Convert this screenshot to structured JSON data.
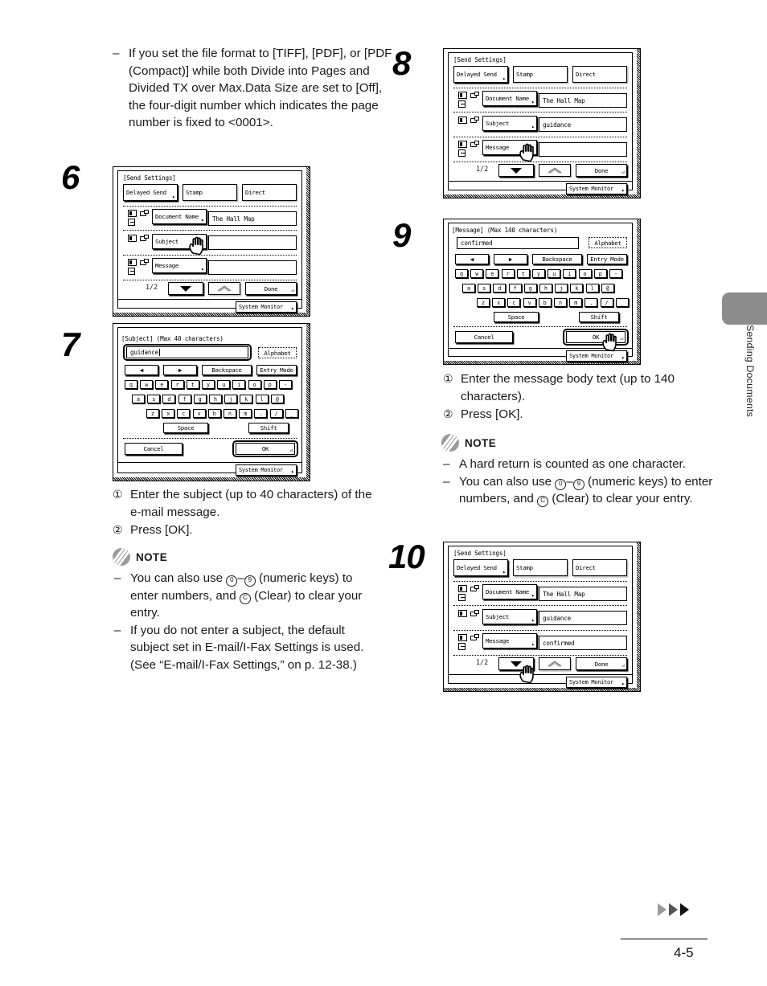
{
  "document": {
    "page_number": "4-5",
    "side_tab": "Sending Documents"
  },
  "left_column": {
    "intro_note": {
      "dash": "–",
      "text": "If you set the file format to [TIFF], [PDF], or [PDF (Compact)] while both Divide into Pages and Divided TX over Max.Data Size are set to [Off], the four-digit number which indicates the page number is fixed to <0001>."
    },
    "step6": {
      "number": "6",
      "screen": {
        "title": "[Send Settings]",
        "top_buttons": [
          "Delayed Send",
          "Stamp",
          "Direct"
        ],
        "rows": [
          {
            "label": "Document Name",
            "value": "The Hall Map"
          },
          {
            "label": "Subject",
            "value": ""
          },
          {
            "label": "Message",
            "value": ""
          }
        ],
        "page_indicator": "1/2",
        "done_label": "Done",
        "system_monitor": "System Monitor",
        "cursor_on": "Subject"
      }
    },
    "step7": {
      "number": "7",
      "screen": {
        "title": "[Subject] (Max 40 characters)",
        "input_value": "guidance",
        "mode_button": "Alphabet",
        "nav_left": "◀",
        "nav_right": "▶",
        "backspace": "Backspace",
        "entry_mode": "Entry Mode",
        "keys_row1": [
          "q",
          "w",
          "e",
          "r",
          "t",
          "y",
          "u",
          "i",
          "o",
          "p",
          "-"
        ],
        "keys_row2": [
          "a",
          "s",
          "d",
          "f",
          "g",
          "h",
          "j",
          "k",
          "l",
          "@"
        ],
        "keys_row3": [
          "z",
          "x",
          "c",
          "v",
          "b",
          "n",
          "m",
          ".",
          "/",
          "_"
        ],
        "space": "Space",
        "shift": "Shift",
        "cancel": "Cancel",
        "ok": "OK",
        "system_monitor": "System Monitor"
      }
    },
    "step7_captions": [
      {
        "num": "①",
        "text": "Enter the subject (up to 40 characters) of the e-mail message."
      },
      {
        "num": "②",
        "text": "Press [OK]."
      }
    ],
    "note": {
      "label": "NOTE",
      "items": [
        {
          "dash": "–",
          "parts": [
            "You can also use ",
            "KEY0",
            "–",
            "KEY9",
            " (numeric keys) to enter numbers, and ",
            "KEYC",
            " (Clear) to clear your entry."
          ]
        },
        {
          "dash": "–",
          "text": "If you do not enter a subject, the default subject set in E-mail/I-Fax Settings is used. (See “E-mail/I-Fax Settings,” on p. 12-38.)"
        }
      ]
    }
  },
  "right_column": {
    "step8": {
      "number": "8",
      "screen": {
        "title": "[Send Settings]",
        "top_buttons": [
          "Delayed Send",
          "Stamp",
          "Direct"
        ],
        "rows": [
          {
            "label": "Document Name",
            "value": "The Hall Map"
          },
          {
            "label": "Subject",
            "value": "guidance"
          },
          {
            "label": "Message",
            "value": ""
          }
        ],
        "page_indicator": "1/2",
        "done_label": "Done",
        "system_monitor": "System Monitor",
        "cursor_on": "Message"
      }
    },
    "step9": {
      "number": "9",
      "screen": {
        "title": "[Message] (Max 140 characters)",
        "input_value": "confirmed",
        "mode_button": "Alphabet",
        "nav_left": "◀",
        "nav_right": "▶",
        "backspace": "Backspace",
        "entry_mode": "Entry Mode",
        "keys_row1": [
          "q",
          "w",
          "e",
          "r",
          "t",
          "y",
          "u",
          "i",
          "o",
          "p",
          "-"
        ],
        "keys_row2": [
          "a",
          "s",
          "d",
          "f",
          "g",
          "h",
          "j",
          "k",
          "l",
          "@"
        ],
        "keys_row3": [
          "z",
          "x",
          "c",
          "v",
          "b",
          "n",
          "m",
          ".",
          "/",
          "_"
        ],
        "space": "Space",
        "shift": "Shift",
        "cancel": "Cancel",
        "ok": "OK",
        "system_monitor": "System Monitor",
        "cursor_on": "OK"
      }
    },
    "step9_captions": [
      {
        "num": "①",
        "text": "Enter the message body text (up to 140 characters)."
      },
      {
        "num": "②",
        "text": "Press [OK]."
      }
    ],
    "note": {
      "label": "NOTE",
      "items": [
        {
          "dash": "–",
          "text": "A hard return is counted as one character."
        },
        {
          "dash": "–",
          "parts": [
            "You can also use ",
            "KEY0",
            "–",
            "KEY9",
            " (numeric keys) to enter numbers, and ",
            "KEYC",
            " (Clear) to clear your entry."
          ]
        }
      ]
    },
    "step10": {
      "number": "10",
      "screen": {
        "title": "[Send Settings]",
        "top_buttons": [
          "Delayed Send",
          "Stamp",
          "Direct"
        ],
        "rows": [
          {
            "label": "Document Name",
            "value": "The Hall Map"
          },
          {
            "label": "Subject",
            "value": "guidance"
          },
          {
            "label": "Message",
            "value": "confirmed"
          }
        ],
        "page_indicator": "1/2",
        "done_label": "Done",
        "system_monitor": "System Monitor",
        "cursor_on": "scroll-down"
      }
    }
  },
  "colors": {
    "note_icon": "#9a9a9a",
    "side_tab": "#8c8c8c",
    "text": "#1a1a1a"
  }
}
